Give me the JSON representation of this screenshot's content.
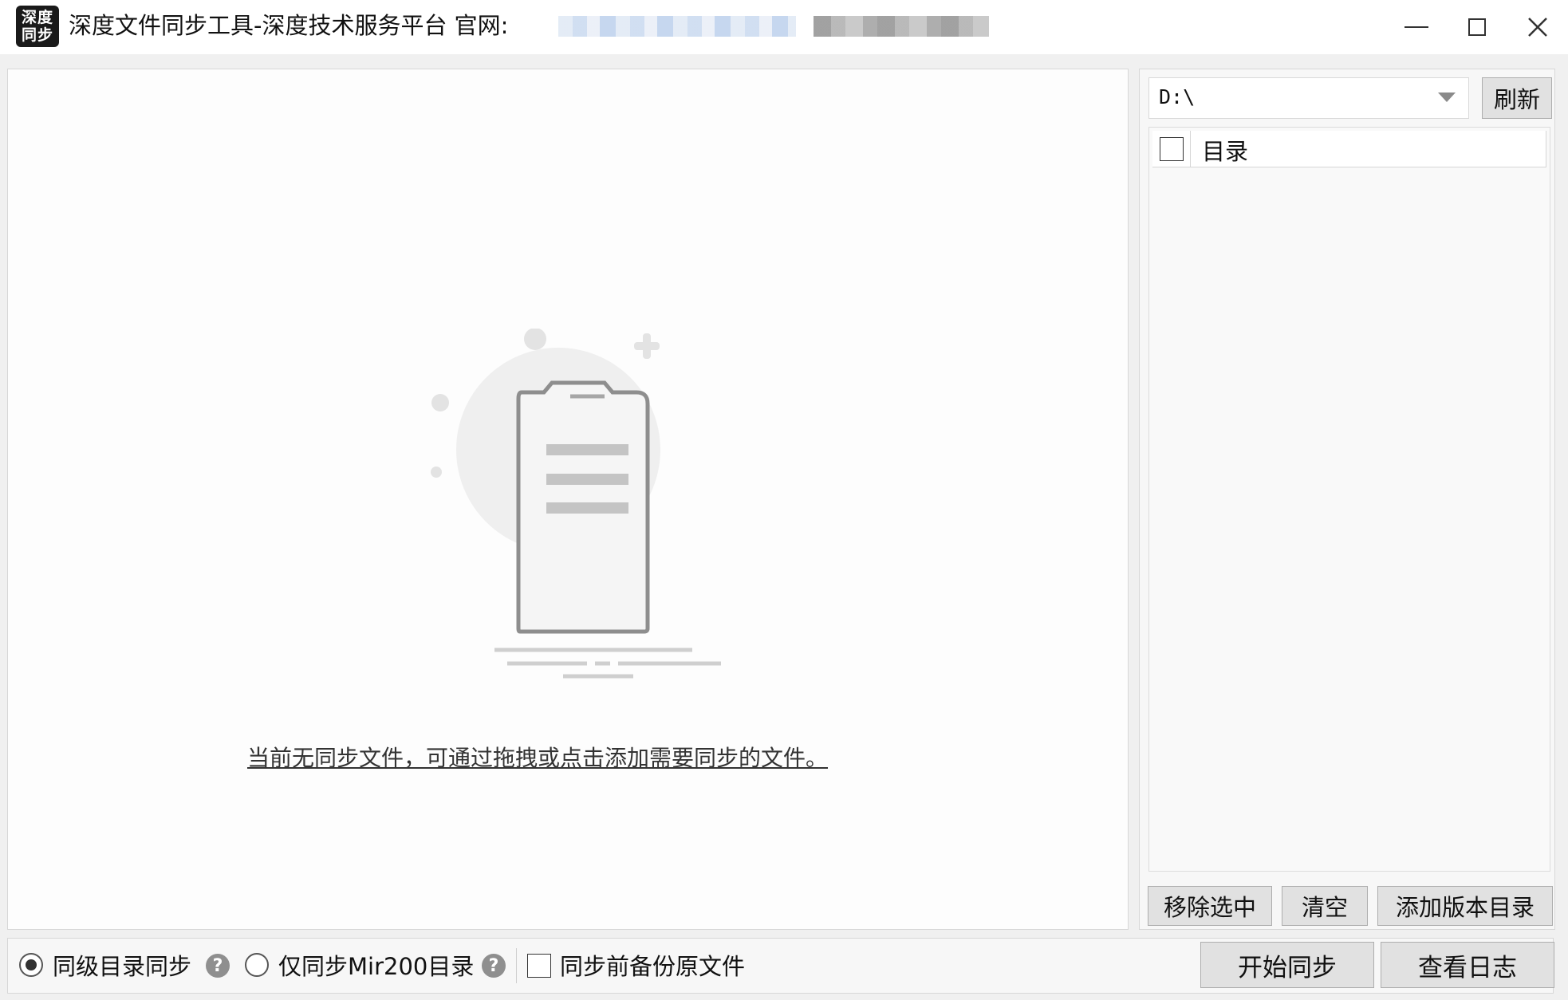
{
  "titlebar": {
    "logo_line1": "深度",
    "logo_line2": "同步",
    "title": "深度文件同步工具-深度技术服务平台 官网:"
  },
  "main": {
    "empty_hint": "当前无同步文件，可通过拖拽或点击添加需要同步的文件。"
  },
  "right": {
    "drive_value": "D:\\",
    "refresh_label": "刷新",
    "list_header_label": "目录",
    "remove_selected_label": "移除选中",
    "clear_label": "清空",
    "add_version_dir_label": "添加版本目录"
  },
  "bottom": {
    "option_same_level": "同级目录同步",
    "option_only_mir200": "仅同步Mir200目录",
    "backup_label": "同步前备份原文件",
    "help_glyph": "?",
    "start_sync_label": "开始同步",
    "view_log_label": "查看日志"
  },
  "colors": {
    "window_bg": "#f0f0f0",
    "button_bg": "#e1e1e1",
    "illustration_gray": "#a6a6a6"
  }
}
